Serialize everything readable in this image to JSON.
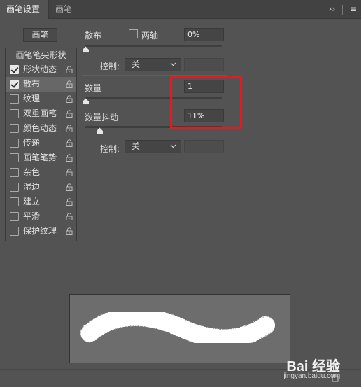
{
  "tabs": [
    {
      "label": "画笔设置",
      "active": true
    },
    {
      "label": "画笔",
      "active": false
    }
  ],
  "tab_menu": {
    "expand_glyph": "››",
    "menu_glyph": "≡"
  },
  "brush_button_label": "画笔",
  "list": {
    "header": "画笔笔尖形状",
    "items": [
      {
        "label": "形状动态",
        "checked": true,
        "selected": false
      },
      {
        "label": "散布",
        "checked": true,
        "selected": true
      },
      {
        "label": "纹理",
        "checked": false,
        "selected": false
      },
      {
        "label": "双重画笔",
        "checked": false,
        "selected": false
      },
      {
        "label": "颜色动态",
        "checked": false,
        "selected": false
      },
      {
        "label": "传递",
        "checked": false,
        "selected": false
      },
      {
        "label": "画笔笔势",
        "checked": false,
        "selected": false
      },
      {
        "label": "杂色",
        "checked": false,
        "selected": false
      },
      {
        "label": "湿边",
        "checked": false,
        "selected": false
      },
      {
        "label": "建立",
        "checked": false,
        "selected": false
      },
      {
        "label": "平滑",
        "checked": false,
        "selected": false
      },
      {
        "label": "保护纹理",
        "checked": false,
        "selected": false
      }
    ]
  },
  "scatter": {
    "label": "散布",
    "both_axes_label": "两轴",
    "both_axes_checked": false,
    "value": "0%",
    "slider_fraction": 0.0,
    "control_label": "控制:",
    "control_value": "关"
  },
  "count": {
    "label": "数量",
    "value": "1",
    "slider_fraction": 0.0
  },
  "count_jitter": {
    "label": "数量抖动",
    "value": "11%",
    "slider_fraction": 0.11,
    "control_label": "控制:",
    "control_value": "关"
  },
  "colors": {
    "panel_bg": "#535353",
    "tab_bg": "#424242",
    "highlight": "#e8191e",
    "preview_bg": "#6d6d6d",
    "stroke": "#ffffff"
  },
  "watermark": {
    "brand": "Bai 经验",
    "url": "jingyan.baidu.com"
  },
  "icons": [
    "lock-icon",
    "chevron-down-icon",
    "expand-icon",
    "menu-icon",
    "new-preset-icon"
  ]
}
